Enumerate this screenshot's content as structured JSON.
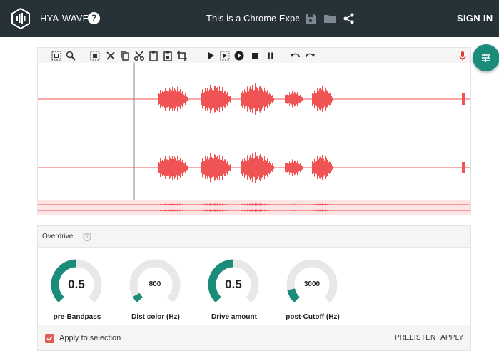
{
  "header": {
    "app_name": "HYA-WAVE",
    "help_glyph": "?",
    "project_title": "This is a Chrome Experi",
    "sign_in_label": "SIGN IN"
  },
  "toolbar": {
    "tools": [
      {
        "name": "select-region-icon"
      },
      {
        "name": "zoom-icon"
      },
      {
        "name": "select-all-icon"
      },
      {
        "name": "delete-icon"
      },
      {
        "name": "copy-icon"
      },
      {
        "name": "cut-icon"
      },
      {
        "name": "paste-icon"
      },
      {
        "name": "paste-mix-icon"
      },
      {
        "name": "crop-icon"
      },
      {
        "name": "play-icon"
      },
      {
        "name": "play-selection-icon"
      },
      {
        "name": "loop-play-icon"
      },
      {
        "name": "stop-icon"
      },
      {
        "name": "pause-icon"
      },
      {
        "name": "undo-icon"
      },
      {
        "name": "redo-icon"
      }
    ],
    "record_icon": "microphone-icon"
  },
  "effects": {
    "title": "Overdrive",
    "knobs": [
      {
        "value": "0.5",
        "label": "pre-Bandpass",
        "fraction": 0.5
      },
      {
        "value": "800",
        "label": "Dist color (Hz)",
        "fraction": 0.06
      },
      {
        "value": "0.5",
        "label": "Drive amount",
        "fraction": 0.5
      },
      {
        "value": "3000",
        "label": "post-Cutoff (Hz)",
        "fraction": 0.12
      }
    ],
    "apply_to_selection_label": "Apply to selection",
    "apply_to_selection_checked": true,
    "prelisten_label": "PRELISTEN",
    "apply_label": "APPLY"
  },
  "colors": {
    "header_bg": "#263238",
    "accent": "#1b8c7a",
    "waveform": "#f05353",
    "record": "#e53935"
  }
}
